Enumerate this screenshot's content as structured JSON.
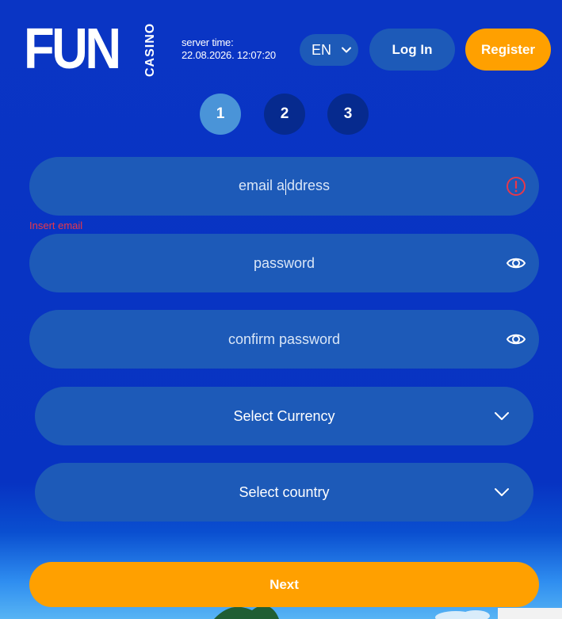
{
  "header": {
    "logo_main": "FUN",
    "logo_sub": "CASINO",
    "server_time_label": "server time:",
    "server_time_value": "22.08.2026. 12:07:20",
    "language": "EN",
    "login_label": "Log In",
    "register_label": "Register"
  },
  "steps": [
    "1",
    "2",
    "3"
  ],
  "active_step": 1,
  "form": {
    "email": {
      "placeholder_before_caret": "email a",
      "placeholder_after_caret": "ddress",
      "error": "Insert email",
      "icon": "error-circle-icon"
    },
    "password": {
      "placeholder": "password",
      "icon": "eye-icon"
    },
    "confirm_password": {
      "placeholder": "confirm password",
      "icon": "eye-icon"
    },
    "currency": {
      "label": "Select Currency",
      "icon": "chevron-down-icon"
    },
    "country": {
      "label": "Select country",
      "icon": "chevron-down-icon"
    },
    "next_label": "Next"
  },
  "colors": {
    "background": "#0733c2",
    "field": "#1d5ab8",
    "accent": "#ffa000",
    "error": "#e8384a",
    "step_active": "#4a94d8",
    "step_inactive": "#062a8e"
  }
}
